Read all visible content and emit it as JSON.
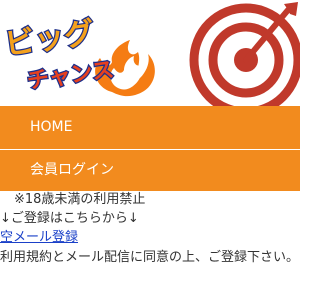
{
  "logo": {
    "line1": "ビッグ",
    "line2": "チャンス"
  },
  "nav": {
    "home_label": "HOME",
    "login_label": "会員ログイン"
  },
  "content": {
    "age_notice": "※18歳未満の利用禁止",
    "register_hint": "↓ご登録はこちらから↓",
    "empty_mail_link": "空メール登録",
    "terms_text": "利用規約とメール配信に同意の上、ご登録下さい。"
  },
  "colors": {
    "accent": "#f28b1e",
    "link": "#1a40c8",
    "target_red": "#c0392b"
  },
  "icons": {
    "target": "target-icon",
    "flame": "flame-icon"
  }
}
